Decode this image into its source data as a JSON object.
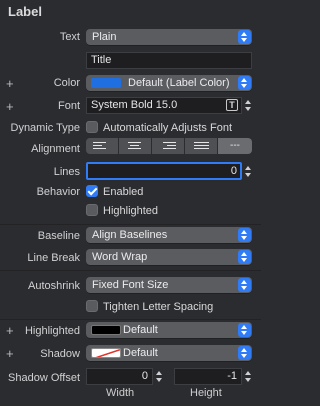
{
  "header": {
    "title": "Label"
  },
  "text": {
    "label": "Text",
    "type": "Plain",
    "value": "Title"
  },
  "color": {
    "label": "Color",
    "value": "Default (Label Color)",
    "swatch": "#1f6fe0"
  },
  "font": {
    "label": "Font",
    "value": "System Bold 15.0"
  },
  "dynamic_type": {
    "label": "Dynamic Type",
    "option": "Automatically Adjusts Font",
    "checked": false
  },
  "alignment": {
    "label": "Alignment",
    "natural_label": "---",
    "selected": "natural"
  },
  "lines": {
    "label": "Lines",
    "value": "0"
  },
  "behavior": {
    "label": "Behavior",
    "enabled": {
      "label": "Enabled",
      "checked": true
    },
    "highlighted": {
      "label": "Highlighted",
      "checked": false
    }
  },
  "baseline": {
    "label": "Baseline",
    "value": "Align Baselines"
  },
  "line_break": {
    "label": "Line Break",
    "value": "Word Wrap"
  },
  "autoshrink": {
    "label": "Autoshrink",
    "value": "Fixed Font Size",
    "tighten": {
      "label": "Tighten Letter Spacing",
      "checked": false
    }
  },
  "highlighted_color": {
    "label": "Highlighted",
    "value": "Default",
    "swatch": "#000000"
  },
  "shadow": {
    "label": "Shadow",
    "value": "Default"
  },
  "shadow_offset": {
    "label": "Shadow Offset",
    "width": {
      "value": "0",
      "caption": "Width"
    },
    "height": {
      "value": "-1",
      "caption": "Height"
    }
  },
  "colors": {
    "accent": "#2f7cf6",
    "panel": "#2b2c2f",
    "popup": "#5b5c60"
  }
}
